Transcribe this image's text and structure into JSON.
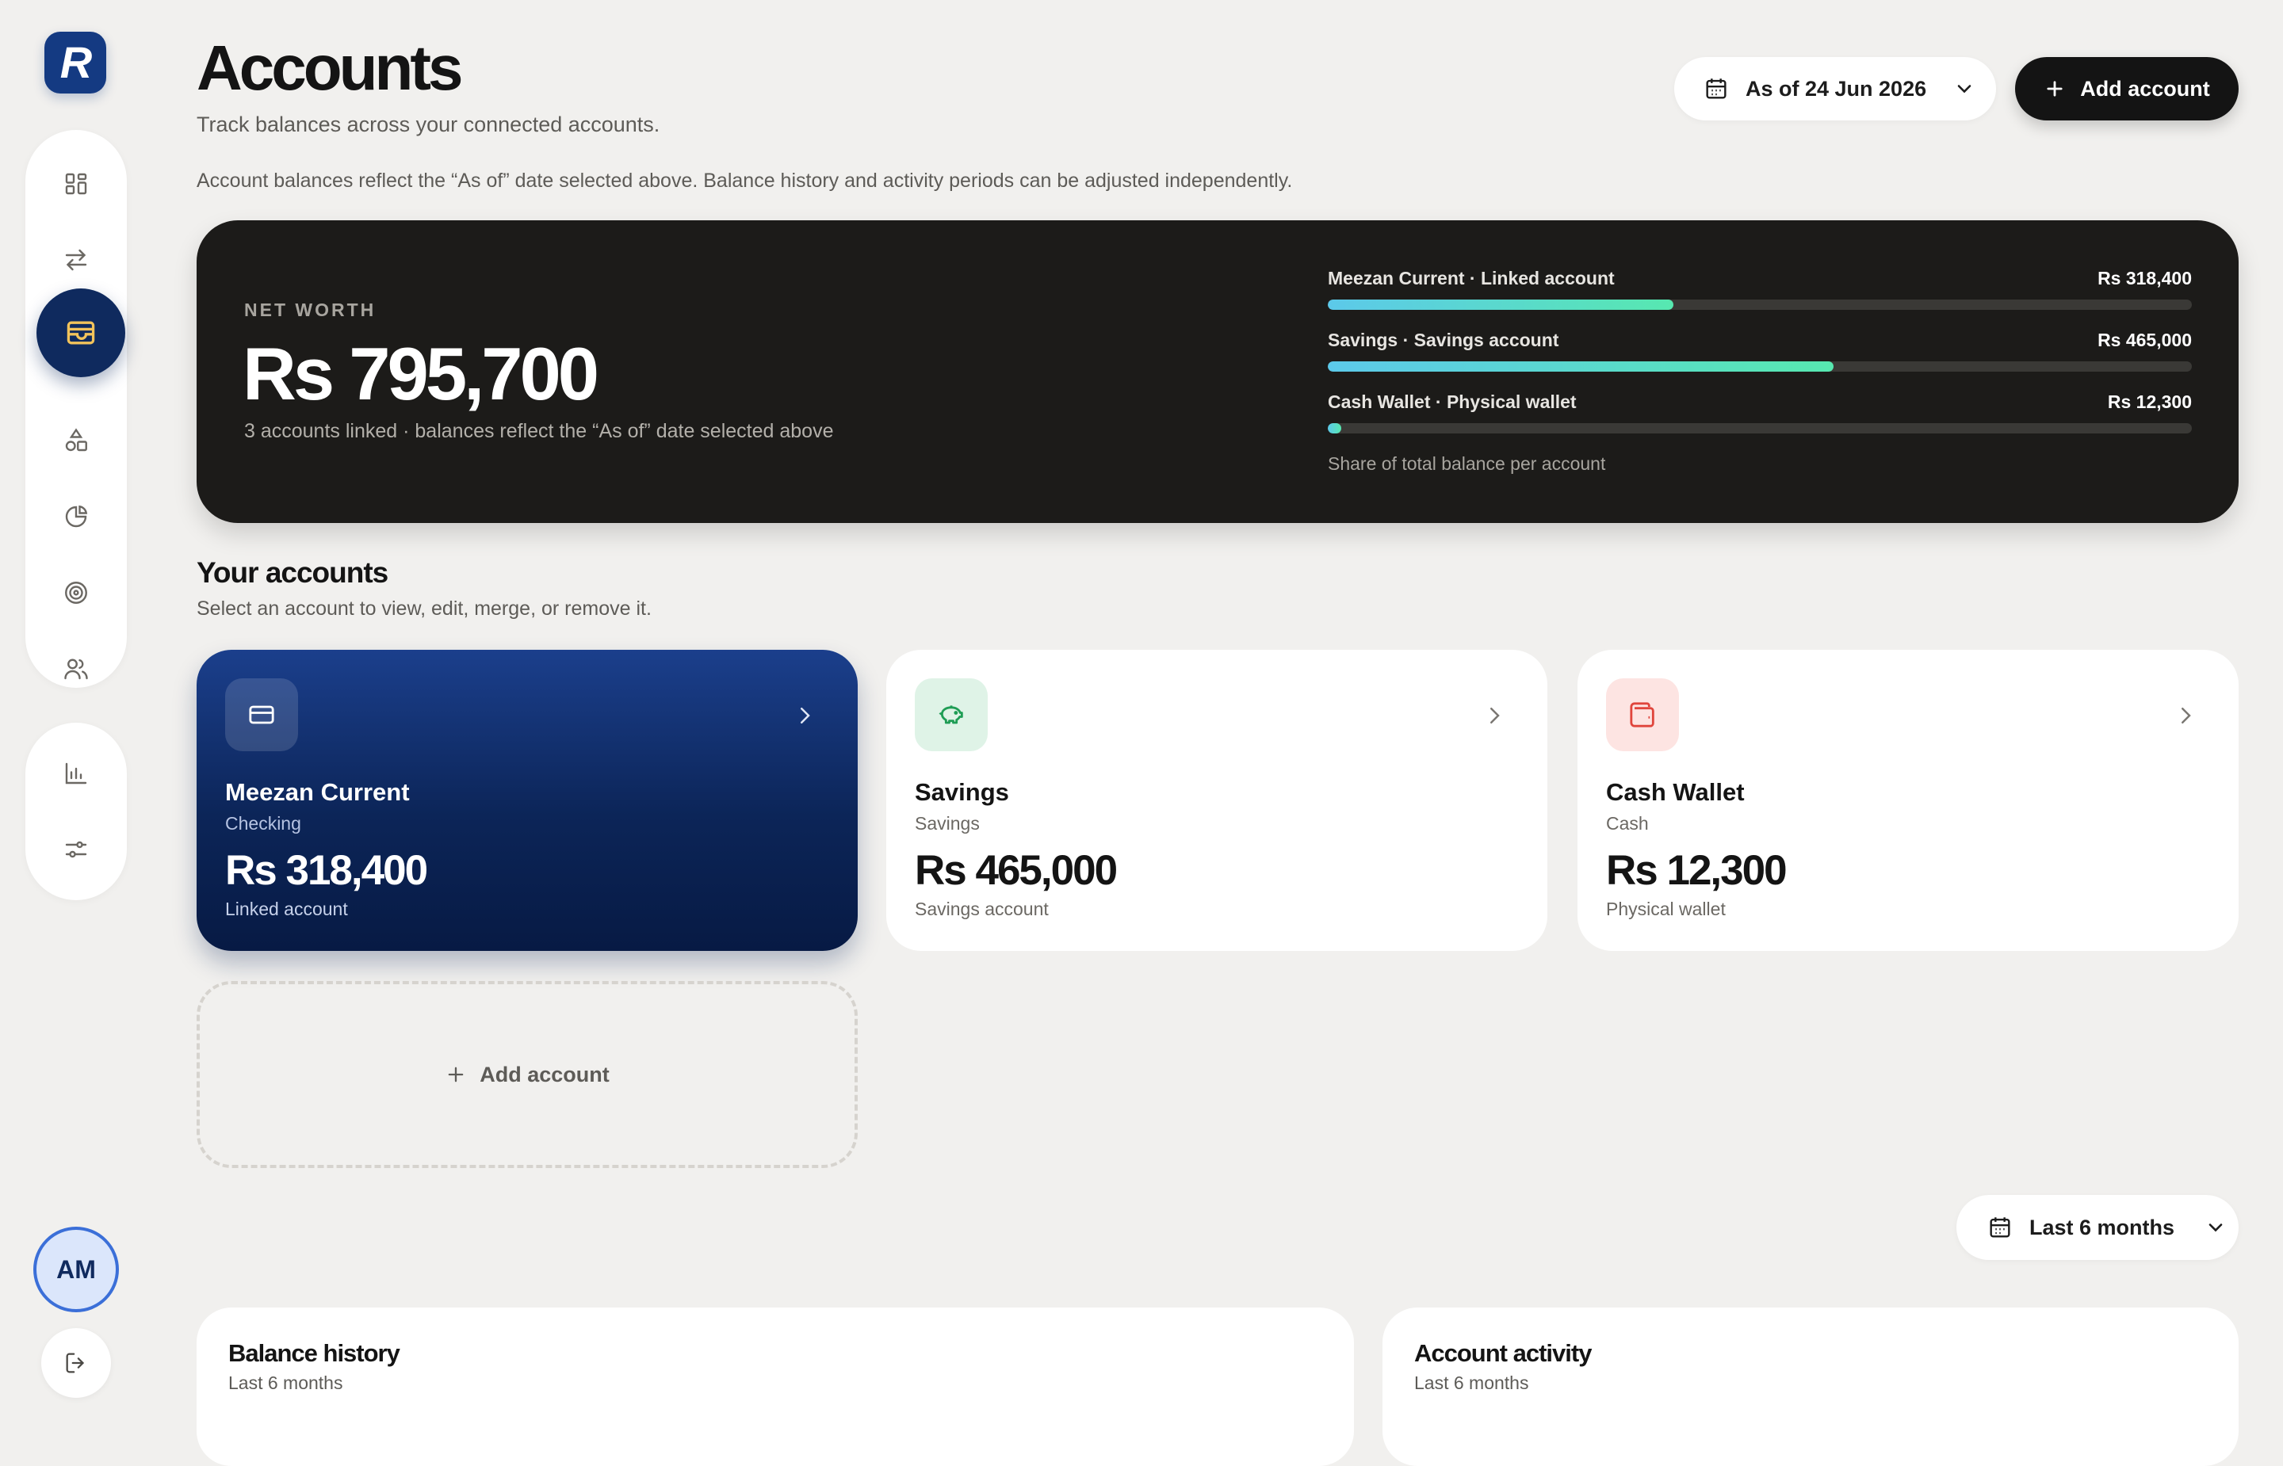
{
  "brand": {
    "logo_letter": "R"
  },
  "nav": {
    "items": [
      {
        "name": "dashboard",
        "icon": "grid-icon"
      },
      {
        "name": "transactions",
        "icon": "arrows-swap-icon"
      },
      {
        "name": "accounts",
        "icon": "wallet-icon",
        "active": true
      },
      {
        "name": "categories",
        "icon": "shapes-icon"
      },
      {
        "name": "budgets",
        "icon": "pie-chart-icon"
      },
      {
        "name": "goals",
        "icon": "target-icon"
      },
      {
        "name": "people",
        "icon": "users-icon"
      },
      {
        "name": "reports",
        "icon": "bar-chart-icon"
      },
      {
        "name": "settings",
        "icon": "sliders-icon"
      }
    ]
  },
  "user": {
    "initials": "AM"
  },
  "header": {
    "title": "Accounts",
    "subtitle": "Track balances across your connected accounts.",
    "note": "Account balances reflect the “As of” date selected above. Balance history and activity periods can be adjusted independently.",
    "as_of_label": "As of 24 Jun 2026",
    "add_account_label": "Add account"
  },
  "net_worth": {
    "label": "NET WORTH",
    "value": "Rs 795,700",
    "subtitle": "3 accounts linked · balances reflect the “As of” date selected above",
    "caption": "Share of total balance per account",
    "shares": [
      {
        "label": "Meezan Current · Linked account",
        "amount": "Rs 318,400",
        "share": 0.4
      },
      {
        "label": "Savings · Savings account",
        "amount": "Rs 465,000",
        "share": 0.585
      },
      {
        "label": "Cash Wallet · Physical wallet",
        "amount": "Rs 12,300",
        "share": 0.015
      }
    ]
  },
  "accounts_section": {
    "title": "Your accounts",
    "subtitle": "Select an account to view, edit, merge, or remove it.",
    "accounts": [
      {
        "name": "Meezan Current",
        "type": "Checking",
        "balance": "Rs 318,400",
        "description": "Linked account",
        "icon": "card-icon"
      },
      {
        "name": "Savings",
        "type": "Savings",
        "balance": "Rs 465,000",
        "description": "Savings account",
        "icon": "piggy-bank-icon",
        "accent": "#1f9d55"
      },
      {
        "name": "Cash Wallet",
        "type": "Cash",
        "balance": "Rs 12,300",
        "description": "Physical wallet",
        "icon": "wallet-icon",
        "accent": "#e0453c"
      }
    ],
    "add_tile_label": "Add account"
  },
  "period": {
    "label": "Last 6 months"
  },
  "panels": {
    "balance_history": {
      "title": "Balance history",
      "subtitle": "Last 6 months"
    },
    "account_activity": {
      "title": "Account activity",
      "subtitle": "Last 6 months"
    }
  }
}
